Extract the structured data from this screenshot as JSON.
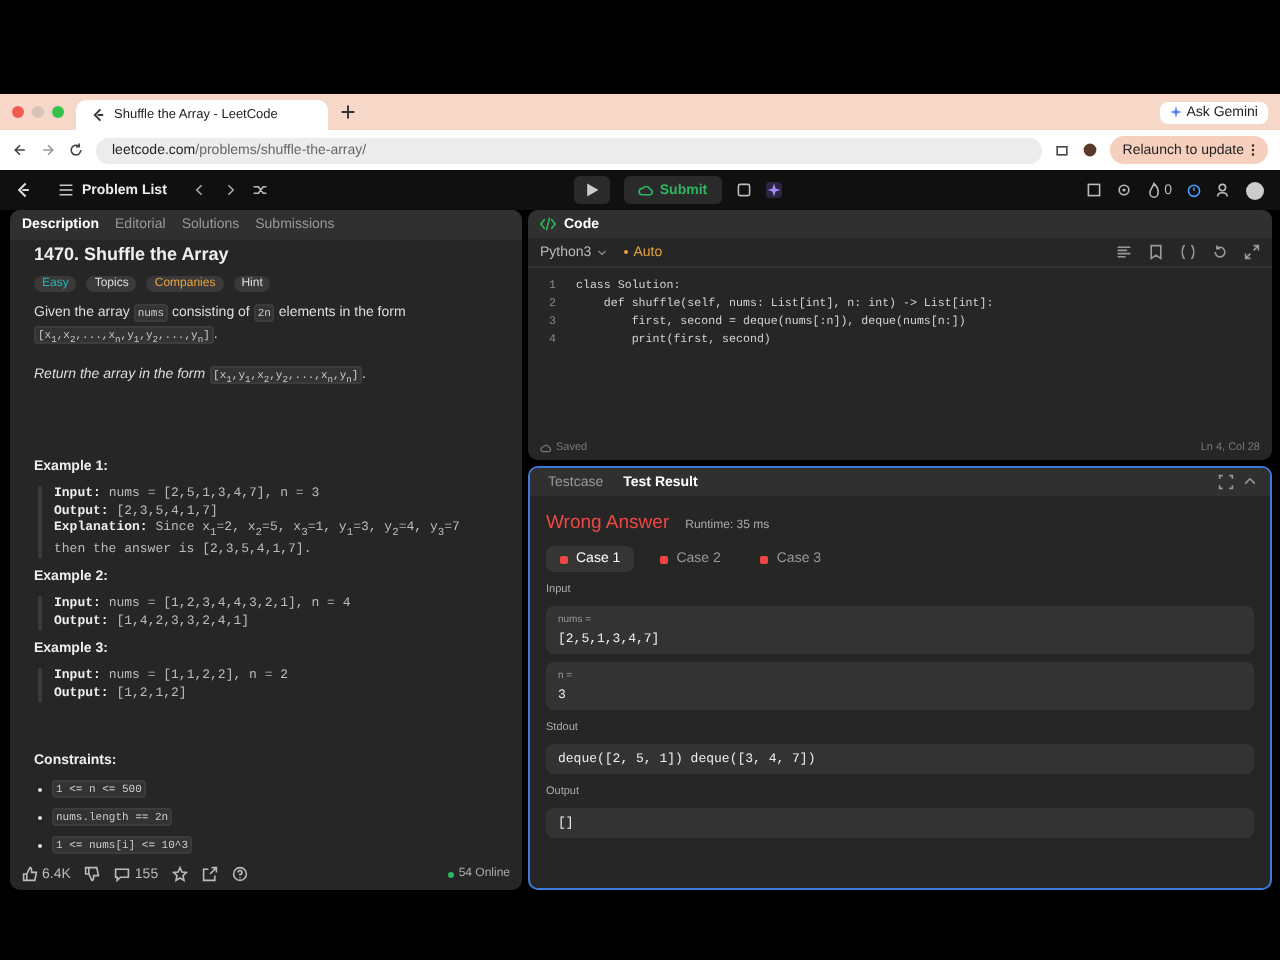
{
  "browser": {
    "tabs": [
      {
        "title": "Shuffle the Array - LeetCode",
        "selected": true
      }
    ],
    "ask_gemini": "Ask Gemini",
    "url_host": "leetcode.com",
    "url_path": "/problems/shuffle-the-array/",
    "relaunch": "Relaunch to update"
  },
  "app_bar": {
    "problem_list": "Problem List",
    "submit": "Submit",
    "streak": "0"
  },
  "description_panel": {
    "tabs": [
      {
        "label": "Description",
        "selected": true
      },
      {
        "label": "Editorial",
        "selected": false
      },
      {
        "label": "Solutions",
        "selected": false
      },
      {
        "label": "Submissions",
        "selected": false
      }
    ],
    "title": "1470. Shuffle the Array",
    "tags": [
      {
        "label": "Easy",
        "kind": "difficulty"
      },
      {
        "label": "Topics",
        "kind": "topics"
      },
      {
        "label": "Companies",
        "kind": "companies"
      },
      {
        "label": "Hint",
        "kind": "hint"
      }
    ],
    "paragraphs": [
      {
        "italic": false,
        "parts": [
          {
            "kind": "text",
            "text": "Given the array "
          },
          {
            "kind": "code",
            "text": "nums"
          },
          {
            "kind": "text",
            "text": " consisting of "
          },
          {
            "kind": "code",
            "text": "2n"
          },
          {
            "kind": "text",
            "text": " elements in the form "
          },
          {
            "kind": "code",
            "text": "[x$_{1}$,x$_{2}$,...,x$_{n}$,y$_{1}$,y$_{2}$,...,y$_{n}$]"
          },
          {
            "kind": "text",
            "text": "."
          }
        ]
      },
      {
        "italic": true,
        "parts": [
          {
            "kind": "text",
            "text": "Return the array in the form "
          },
          {
            "kind": "code",
            "text": "[x$_{1}$,y$_{1}$,x$_{2}$,y$_{2}$,...,x$_{n}$,y$_{n}$]"
          },
          {
            "kind": "text",
            "text": "."
          }
        ]
      }
    ],
    "examples": [
      {
        "title": "Example 1:",
        "lines": [
          {
            "label": "Input:",
            "value": "nums = [2,5,1,3,4,7], n = 3"
          },
          {
            "label": "Output:",
            "value": "[2,3,5,4,1,7]"
          },
          {
            "label": "Explanation:",
            "value": "Since x$_{1}$=2, x$_{2}$=5, x$_{3}$=1, y$_{1}$=3, y$_{2}$=4, y$_{3}$=7 then the answer is [2,3,5,4,1,7]."
          }
        ]
      },
      {
        "title": "Example 2:",
        "lines": [
          {
            "label": "Input:",
            "value": "nums = [1,2,3,4,4,3,2,1], n = 4"
          },
          {
            "label": "Output:",
            "value": "[1,4,2,3,3,2,4,1]"
          }
        ]
      },
      {
        "title": "Example 3:",
        "lines": [
          {
            "label": "Input:",
            "value": "nums = [1,1,2,2], n = 2"
          },
          {
            "label": "Output:",
            "value": "[1,2,1,2]"
          }
        ]
      }
    ],
    "constraints_title": "Constraints:",
    "constraints": [
      "1 <= n <= 500",
      "nums.length == 2n",
      "1 <= nums[i] <= 10^3"
    ],
    "footer": {
      "likes": "6.4K",
      "comments": "155",
      "online": "54 Online"
    }
  },
  "code_panel": {
    "title": "Code",
    "language": "Python3",
    "mode": "Auto",
    "lines": [
      {
        "number": "1",
        "code": "class Solution:"
      },
      {
        "number": "2",
        "code": "    def shuffle(self, nums: List[int], n: int) -> List[int]:"
      },
      {
        "number": "3",
        "code": "        first, second = deque(nums[:n]), deque(nums[n:])"
      },
      {
        "number": "4",
        "code": "        print(first, second)"
      }
    ],
    "status": "Saved",
    "cursor": "Ln 4, Col 28"
  },
  "result_panel": {
    "tabs": [
      {
        "label": "Testcase",
        "selected": false
      },
      {
        "label": "Test Result",
        "selected": true
      }
    ],
    "verdict": "Wrong Answer",
    "runtime": "Runtime: 35 ms",
    "cases": [
      {
        "label": "Case 1",
        "selected": true
      },
      {
        "label": "Case 2",
        "selected": false
      },
      {
        "label": "Case 3",
        "selected": false
      }
    ],
    "sections": [
      {
        "label": "Input",
        "fields": [
          {
            "name": "nums =",
            "value": "[2,5,1,3,4,7]"
          },
          {
            "name": "n =",
            "value": "3"
          }
        ]
      },
      {
        "label": "Stdout",
        "fields": [
          {
            "value": "deque([2, 5, 1]) deque([3, 4, 7])"
          }
        ]
      },
      {
        "label": "Output",
        "fields": [
          {
            "value": "[]"
          }
        ]
      }
    ]
  }
}
